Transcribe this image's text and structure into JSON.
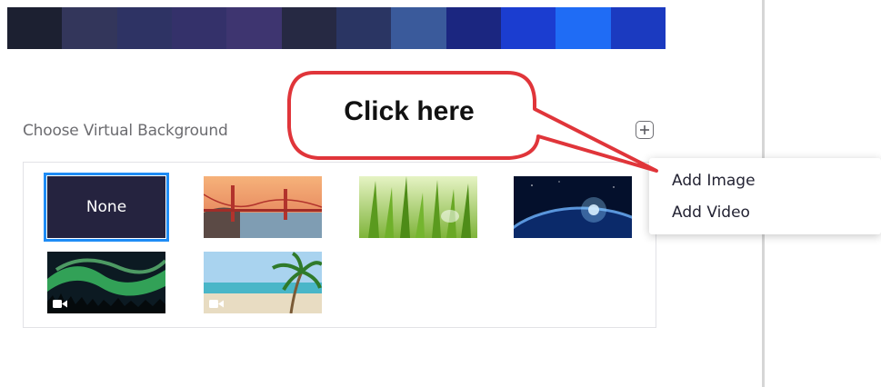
{
  "preview": {
    "strip_colors": [
      "#1c2031",
      "#33365b",
      "#2e3364",
      "#34316a",
      "#3e3570",
      "#262943",
      "#2a3563",
      "#3a5a9b",
      "#1b2680",
      "#1b3dd0",
      "#1f6cf5",
      "#1b3ac0"
    ]
  },
  "virtual_background": {
    "section_label": "Choose Virtual Background",
    "add_icon": "plus-square-icon",
    "tiles": [
      {
        "name": "none",
        "label": "None",
        "selected": true
      },
      {
        "name": "golden-gate-bridge",
        "type": "image"
      },
      {
        "name": "grass",
        "type": "image"
      },
      {
        "name": "earth-from-space",
        "type": "image"
      },
      {
        "name": "aurora",
        "type": "video",
        "badge_icon": "video-camera-icon"
      },
      {
        "name": "beach-palm",
        "type": "video",
        "badge_icon": "video-camera-icon"
      }
    ],
    "selection_color": "#1f8cf5"
  },
  "context_menu": {
    "items": [
      {
        "label": "Add Image"
      },
      {
        "label": "Add Video"
      }
    ]
  },
  "callout": {
    "text": "Click here",
    "border_color": "#e0353a"
  }
}
